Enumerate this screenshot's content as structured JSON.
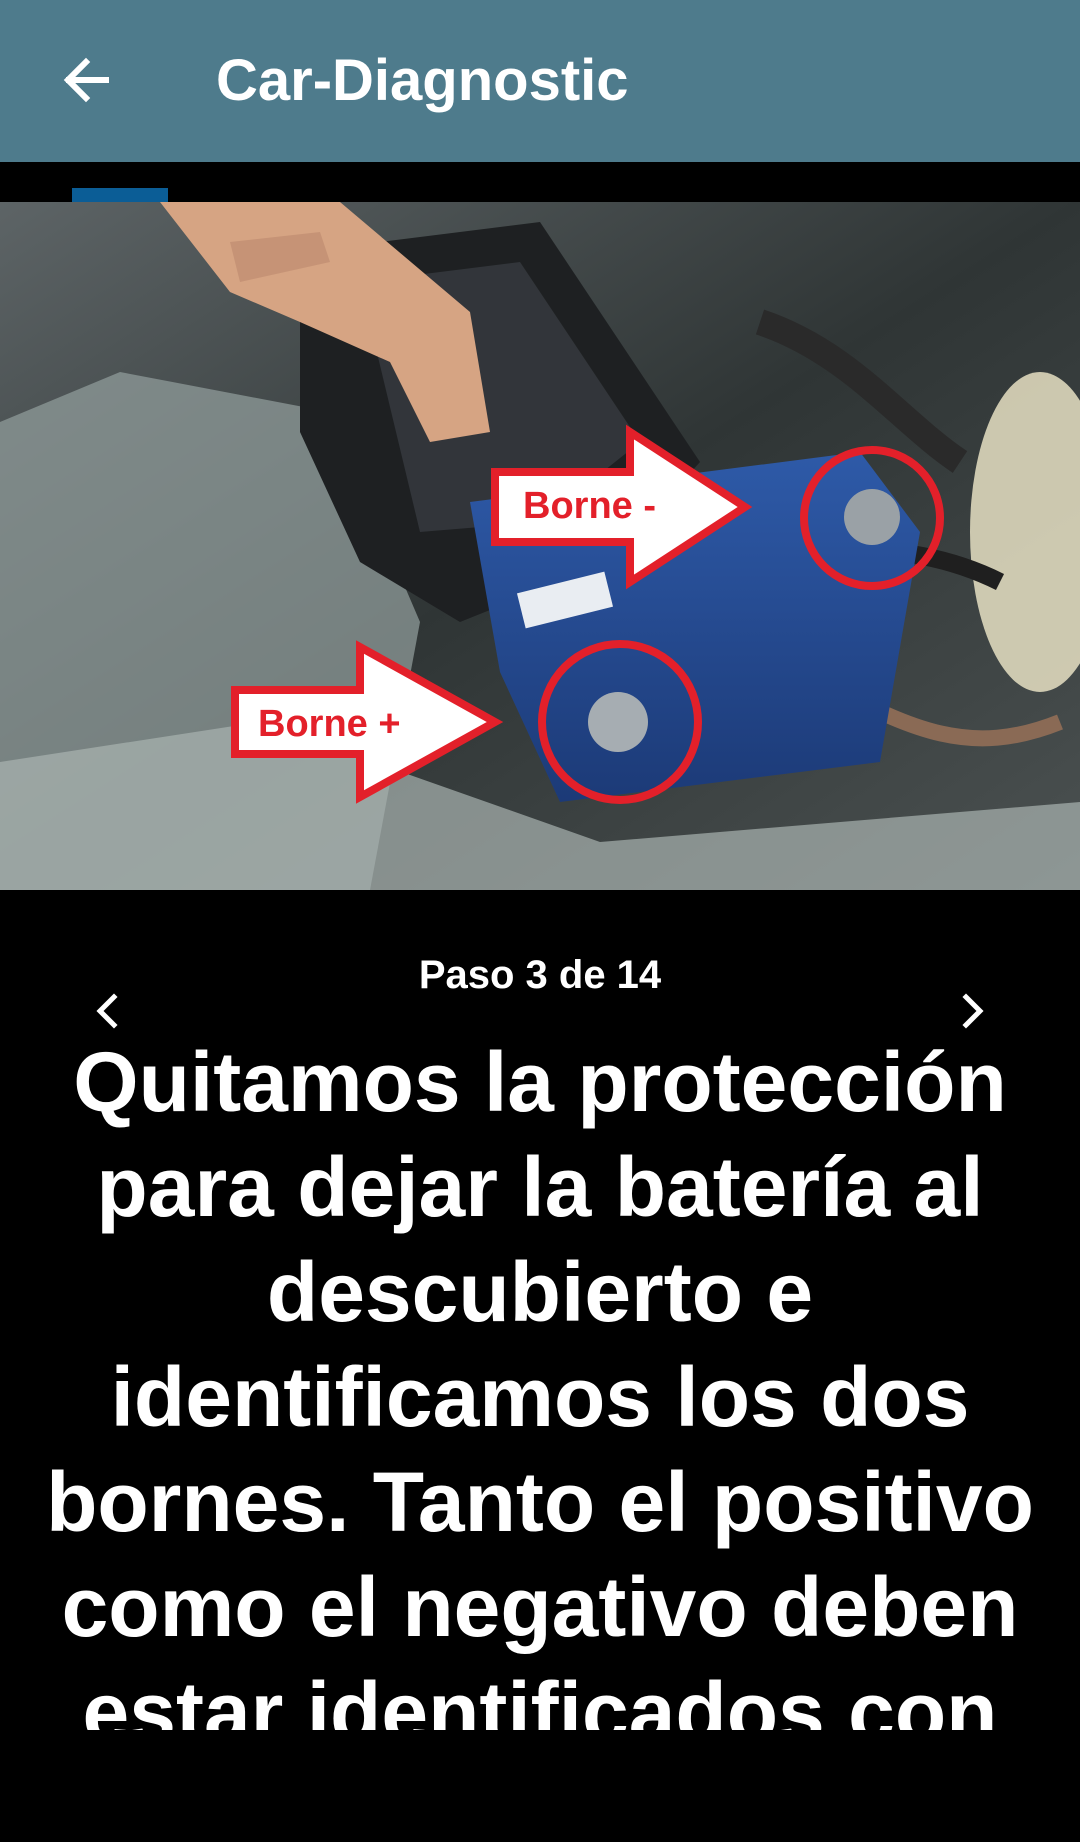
{
  "app_bar": {
    "title": "Car-Diagnostic",
    "back_icon": "arrow-left-icon",
    "background_color": "#4e7b8c"
  },
  "progress": {
    "current_step": 3,
    "total_steps": 14,
    "indicator_color": "#0b5d96"
  },
  "photo": {
    "labels": {
      "negative": "Borne -",
      "positive": "Borne +"
    },
    "annotation_color": "#e3202a"
  },
  "step": {
    "counter_text": "Paso 3 de 14",
    "prev_icon": "chevron-left-icon",
    "next_icon": "chevron-right-icon",
    "instruction": "Quitamos la protección para dejar la batería al descubierto e identificamos los dos bornes. Tanto el positivo como el negativo deben estar identificados con un"
  }
}
